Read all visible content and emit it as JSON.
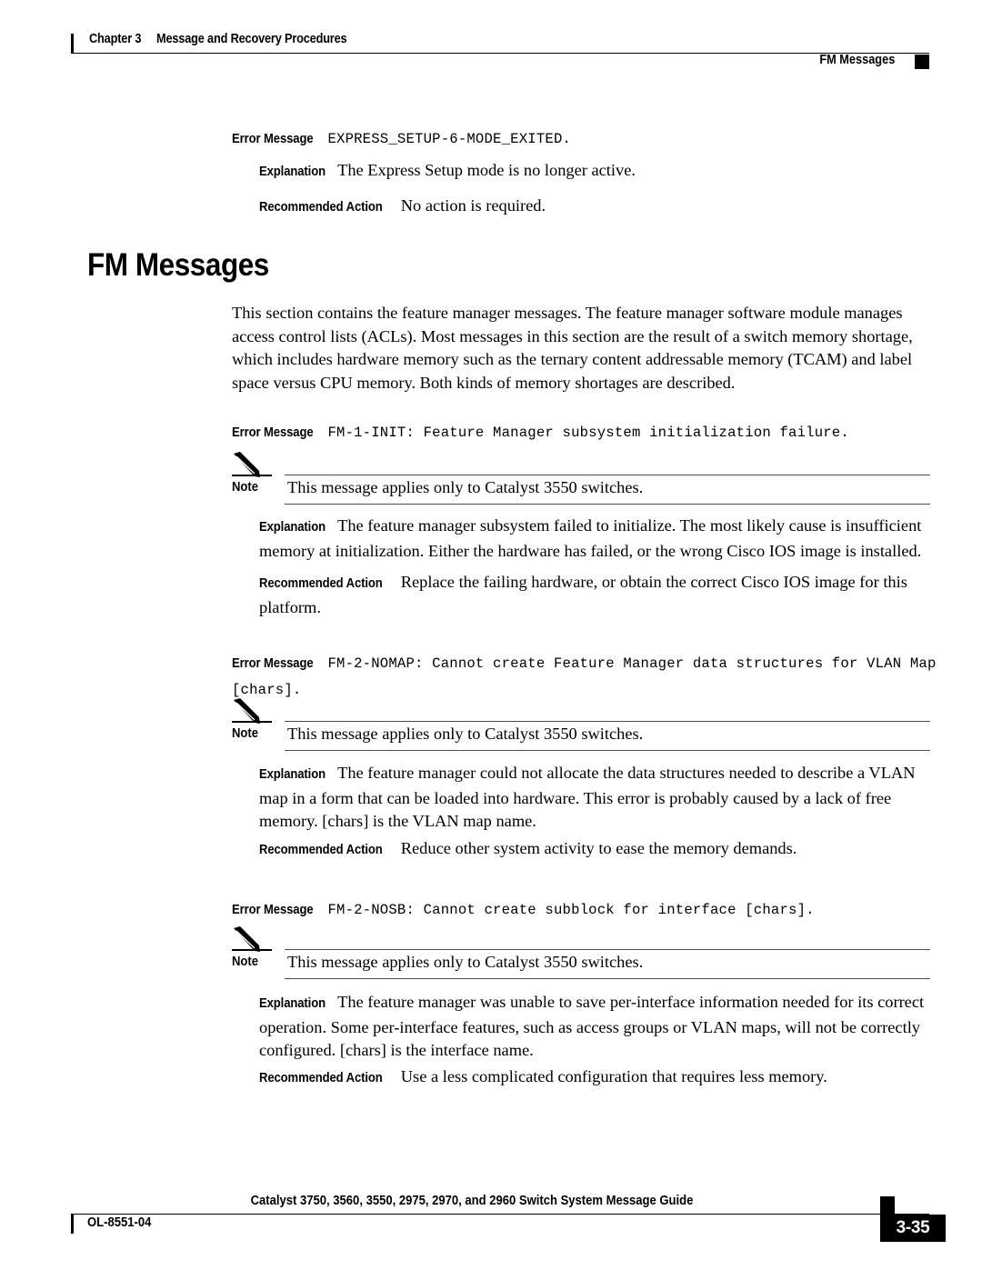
{
  "header": {
    "chapter": "Chapter 3",
    "chapter_title": "Message and Recovery Procedures",
    "section": "FM Messages"
  },
  "labels": {
    "error_message": "Error Message",
    "explanation": "Explanation",
    "recommended_action": "Recommended Action",
    "note": "Note"
  },
  "section_heading": "FM Messages",
  "intro_paragraph": "This section contains the feature manager messages. The feature manager software module manages access control lists (ACLs). Most messages in this section are the result of a switch memory shortage, which includes hardware memory such as the ternary content addressable memory (TCAM) and label space versus CPU memory. Both kinds of memory shortages are described.",
  "messages": [
    {
      "id": "EXPRESS_SETUP-6-MODE_EXITED",
      "error_text": "EXPRESS_SETUP-6-MODE_EXITED.",
      "explanation": "The Express Setup mode is no longer active.",
      "recommended_action": "No action is required."
    },
    {
      "id": "FM-1-INIT",
      "error_text": "FM-1-INIT: Feature Manager subsystem initialization failure.",
      "note": "This message applies only to Catalyst 3550 switches.",
      "explanation": "The feature manager subsystem failed to initialize. The most likely cause is insufficient memory at initialization. Either the hardware has failed, or the wrong Cisco IOS image is installed.",
      "recommended_action": "Replace the failing hardware, or obtain the correct Cisco IOS image for this platform."
    },
    {
      "id": "FM-2-NOMAP",
      "error_text": "FM-2-NOMAP: Cannot create Feature Manager data structures for VLAN Map [chars].",
      "note": "This message applies only to Catalyst 3550 switches.",
      "explanation": "The feature manager could not allocate the data structures needed to describe a VLAN map in a form that can be loaded into hardware. This error is probably caused by a lack of free memory. [chars] is the VLAN map name.",
      "recommended_action": "Reduce other system activity to ease the memory demands."
    },
    {
      "id": "FM-2-NOSB",
      "error_text": "FM-2-NOSB: Cannot create subblock for interface [chars].",
      "note": "This message applies only to Catalyst 3550 switches.",
      "explanation": "The feature manager was unable to save per-interface information needed for its correct operation. Some per-interface features, such as access groups or VLAN maps, will not be correctly configured. [chars] is the interface name.",
      "recommended_action": "Use a less complicated configuration that requires less memory."
    }
  ],
  "footer": {
    "doc_id": "OL-8551-04",
    "guide_title": "Catalyst 3750, 3560, 3550, 2975, 2970, and 2960 Switch System Message Guide",
    "page_number": "3-35"
  }
}
